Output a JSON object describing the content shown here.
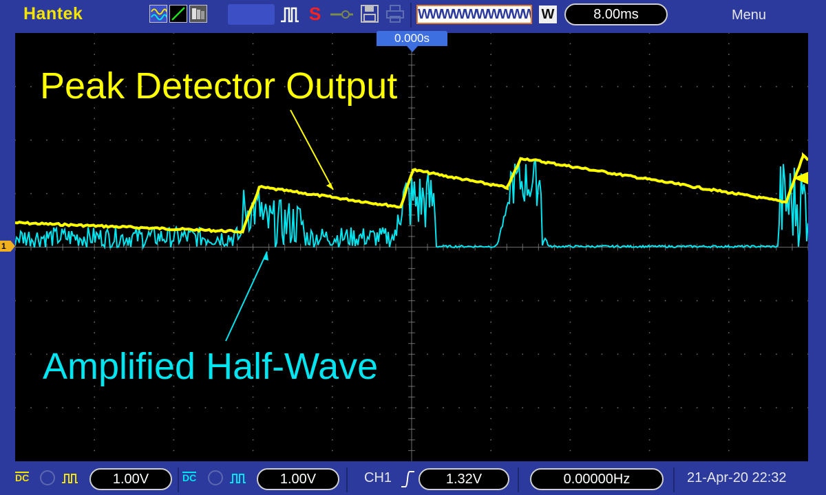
{
  "topbar": {
    "brand": "Hantek",
    "icons": [
      "sine-wave-icon",
      "line-slope-icon",
      "persistence-icon",
      "run-pulse-icon",
      "stop-s-icon",
      "probe-icon",
      "save-disk-icon",
      "print-icon"
    ],
    "stop_label": "S",
    "wave_pattern": "WWWWWWWWWW",
    "timebase_badge": "W",
    "timebase": "8.00ms",
    "menu_label": "Menu"
  },
  "screen": {
    "time_offset": "0.000s",
    "annotation_peak": "Peak Detector Output",
    "annotation_amplified": "Amplified Half-Wave",
    "channel_marker": "1",
    "colors": {
      "peak": "#ffff00",
      "amplified": "#00e5f0",
      "grid": "#6a6a6a"
    }
  },
  "bottombar": {
    "ch1_coupling": "DC",
    "ch1_scale": "1.00V",
    "ch2_coupling": "DC",
    "ch2_scale": "1.00V",
    "trigger_source": "CH1",
    "trigger_level": "1.32V",
    "frequency": "0.00000Hz",
    "datetime": "21-Apr-20 22:32"
  }
}
